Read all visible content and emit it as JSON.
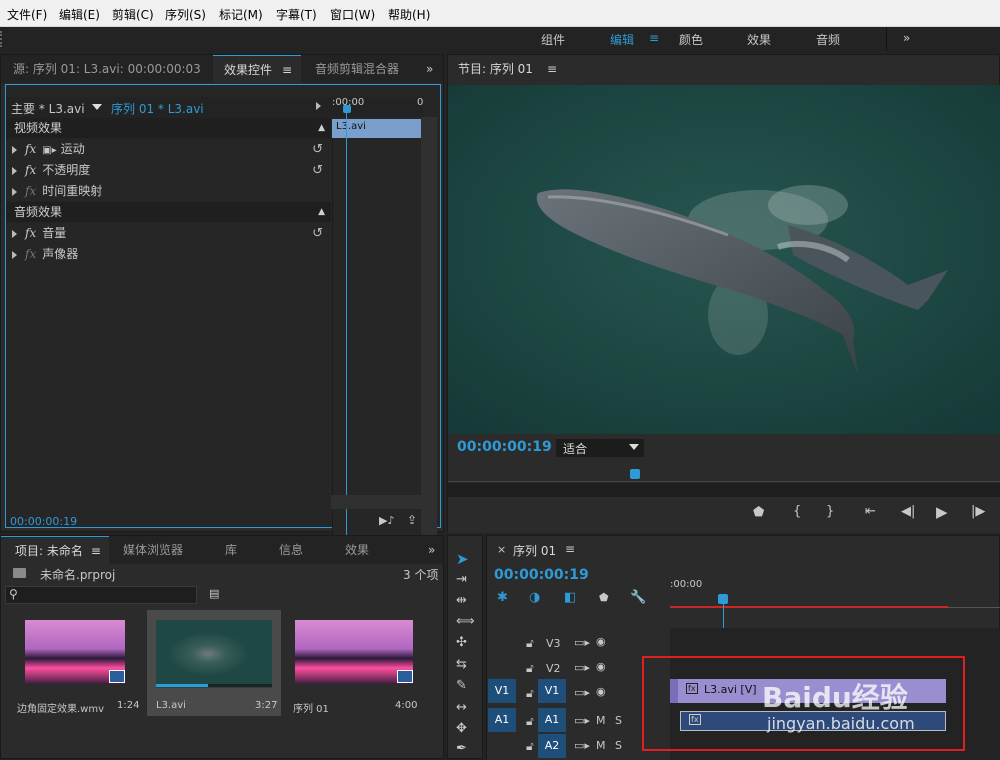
{
  "menu": [
    "文件(F)",
    "编辑(E)",
    "剪辑(C)",
    "序列(S)",
    "标记(M)",
    "字幕(T)",
    "窗口(W)",
    "帮助(H)"
  ],
  "workspaces": [
    "组件",
    "编辑",
    "颜色",
    "效果",
    "音频"
  ],
  "source_panel": {
    "tabs": [
      "源: 序列 01: L3.avi: 00:00:00:03",
      "效果控件",
      "音频剪辑混合器"
    ],
    "master_label": "主要 * L3.avi",
    "sequence_label": "序列 01 * L3.avi",
    "ruler_start": ":00:00",
    "ruler_end": "0",
    "clip_name": "L3.avi",
    "video_section": "视频效果",
    "video_effects": [
      "运动",
      "不透明度",
      "时间重映射"
    ],
    "audio_section": "音频效果",
    "audio_effects": [
      "音量",
      "声像器"
    ],
    "timecode": "00:00:00:19"
  },
  "program_panel": {
    "title": "节目: 序列 01",
    "timecode": "00:00:00:19",
    "zoom": "适合"
  },
  "project_panel": {
    "tabs": [
      "项目: 未命名",
      "媒体浏览器",
      "库",
      "信息",
      "效果"
    ],
    "project_file": "未命名.prproj",
    "item_count": "3 个项",
    "items": [
      {
        "name": "边角固定效果.wmv",
        "duration": "1:24"
      },
      {
        "name": "L3.avi",
        "duration": "3:27"
      },
      {
        "name": "序列 01",
        "duration": "4:00"
      }
    ]
  },
  "timeline": {
    "tab": "序列 01",
    "timecode": "00:00:00:19",
    "ruler_start": ":00:00",
    "tracks": [
      {
        "source": "",
        "name": "V3"
      },
      {
        "source": "",
        "name": "V2"
      },
      {
        "source": "V1",
        "name": "V1"
      },
      {
        "source": "A1",
        "name": "A1"
      },
      {
        "source": "",
        "name": "A2"
      }
    ],
    "mute": "M",
    "solo": "S",
    "video_clip": "L3.avi [V]",
    "fx_badge": "fx"
  },
  "watermark": {
    "brand": "Baidu经验",
    "url": "jingyan.baidu.com"
  },
  "colors": {
    "accent": "#2e9bd6",
    "panel": "#2b2b2b",
    "water": "#1f4844",
    "highlight_box": "#e02020"
  }
}
